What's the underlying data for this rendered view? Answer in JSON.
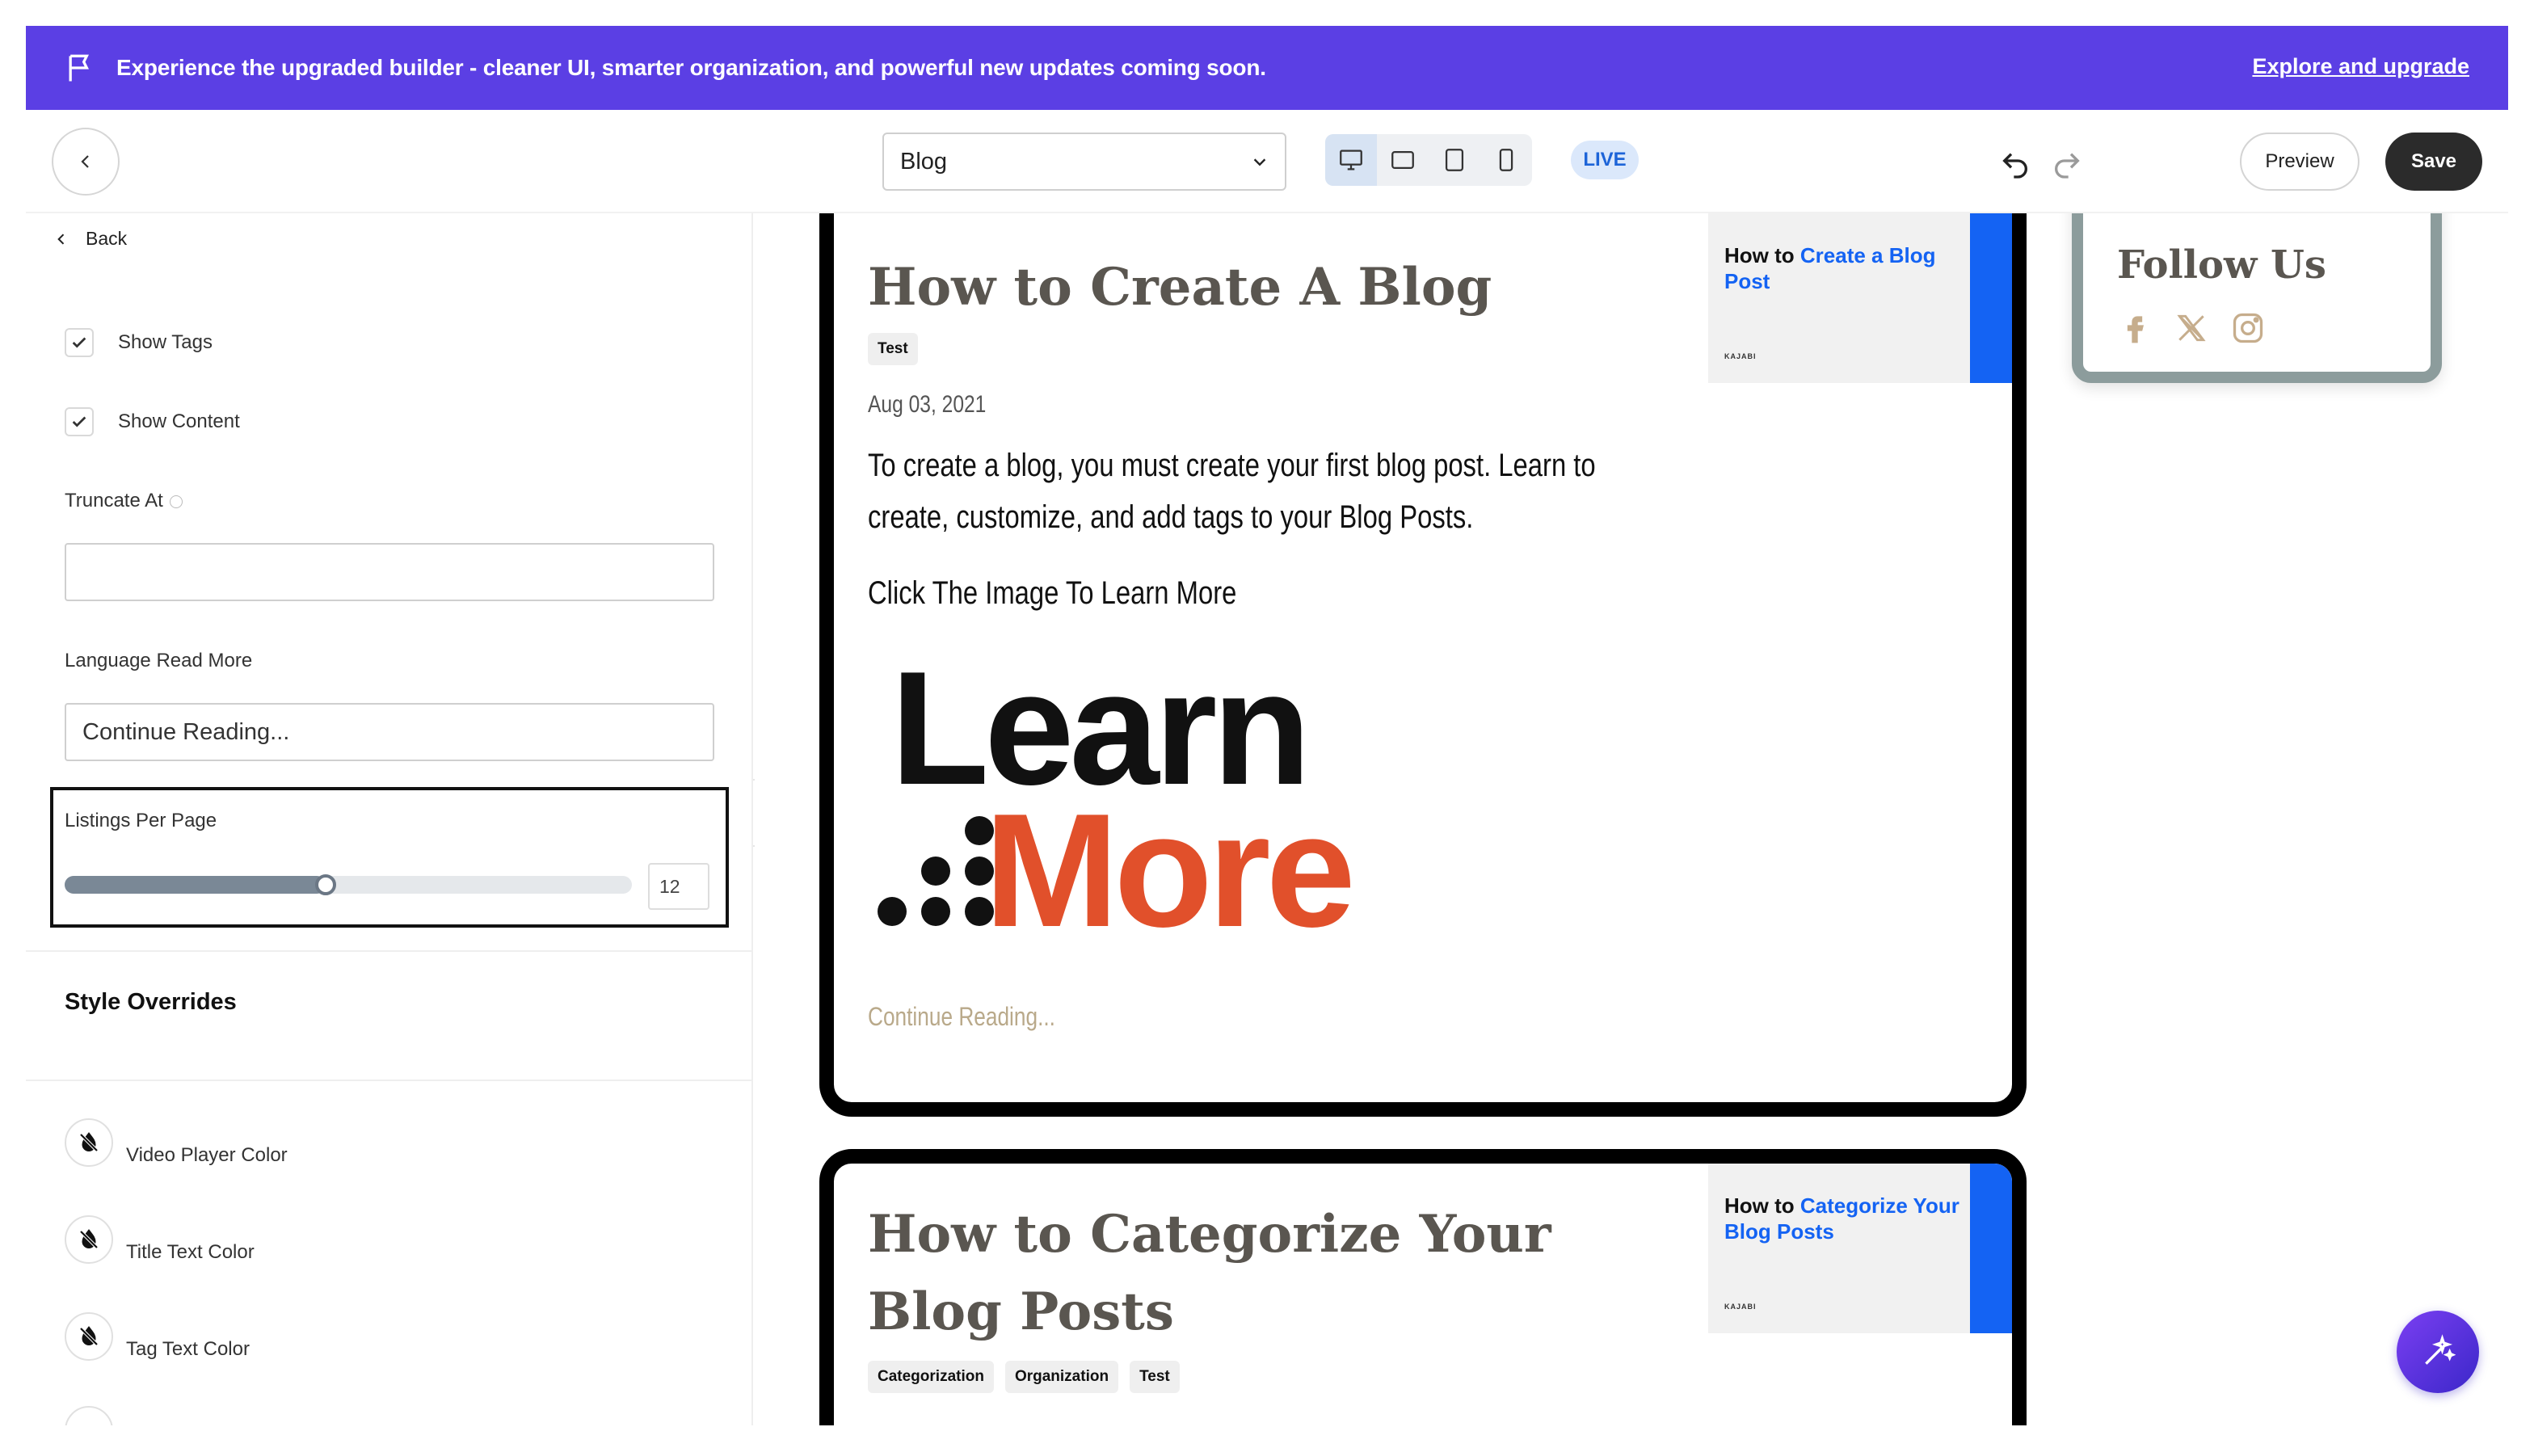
{
  "banner": {
    "text": "Experience the upgraded builder - cleaner UI, smarter organization, and powerful new updates coming soon.",
    "link": "Explore and upgrade",
    "color": "#5b3fe4"
  },
  "topbar": {
    "page_select_value": "Blog",
    "live_badge": "LIVE",
    "preview_label": "Preview",
    "save_label": "Save",
    "devices": [
      "desktop-icon",
      "tablet-landscape-icon",
      "tablet-portrait-icon",
      "mobile-icon"
    ]
  },
  "left_panel": {
    "back_label": "Back",
    "show_tags": {
      "label": "Show Tags",
      "checked": true
    },
    "show_content": {
      "label": "Show Content",
      "checked": true
    },
    "truncate_at": {
      "label": "Truncate At",
      "value": ""
    },
    "language_read_more": {
      "label": "Language Read More",
      "value": "Continue Reading..."
    },
    "listings_per_page": {
      "label": "Listings Per Page",
      "value": "12",
      "fraction": 0.46
    },
    "style_overrides_title": "Style Overrides",
    "color_overrides": [
      {
        "label": "Video Player Color"
      },
      {
        "label": "Title Text Color"
      },
      {
        "label": "Tag Text Color"
      }
    ]
  },
  "posts": [
    {
      "title": "How to Create A Blog",
      "tags": [
        "Test"
      ],
      "date": "Aug 03, 2021",
      "body": "To create a blog, you must create your first blog post. Learn to create, customize, and add tags to your Blog Posts.",
      "click_text": "Click The Image  To Learn More",
      "image_words": [
        "Learn",
        "More"
      ],
      "continue": "Continue Reading...",
      "thumb_prefix": "How to ",
      "thumb_highlight": "Create a Blog Post",
      "thumb_logo": "KAJABI"
    },
    {
      "title": "How to Categorize Your Blog Posts",
      "tags": [
        "Categorization",
        "Organization",
        "Test"
      ],
      "thumb_prefix": "How to ",
      "thumb_highlight": "Categorize Your Blog Posts",
      "thumb_logo": "KAJABI"
    }
  ],
  "follow": {
    "title": "Follow Us",
    "icons": [
      "facebook-icon",
      "x-icon",
      "instagram-icon"
    ],
    "icon_color": "#c6ad8c"
  },
  "colors": {
    "accent_blue": "#1463f3",
    "learn_more_orange": "#e1502b"
  }
}
